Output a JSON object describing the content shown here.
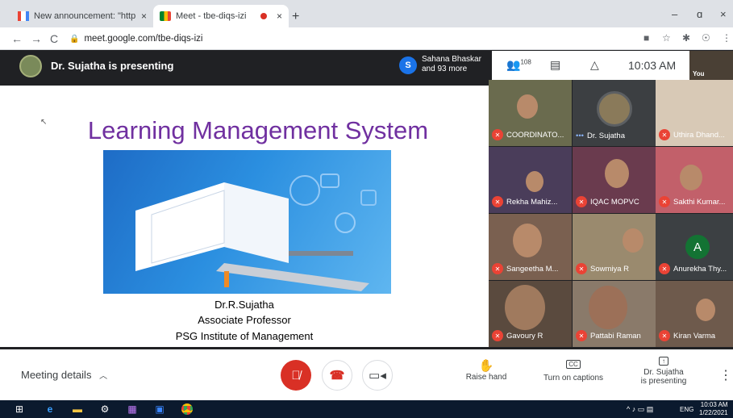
{
  "browser": {
    "tabs": [
      {
        "title": "New announcement: \"http://mee"
      },
      {
        "title": "Meet - tbe-diqs-izi"
      }
    ],
    "new_tab": "+",
    "close": "×",
    "window_controls": {
      "minimize": "–",
      "restore": "ɑ",
      "close": "×"
    },
    "address": "meet.google.com/tbe-diqs-izi",
    "nav": {
      "back": "←",
      "forward": "→",
      "reload": "C"
    }
  },
  "meet": {
    "presenting_text": "Dr. Sujatha is presenting",
    "viewers": {
      "initial": "S",
      "line1": "Sahana Bhaskar",
      "line2": "and 93 more"
    },
    "people_count": "108",
    "clock": "10:03 AM",
    "you_label": "You"
  },
  "slide": {
    "title": "Learning Management System",
    "lines": [
      "Dr.R.Sujatha",
      "Associate Professor",
      "PSG Institute of Management"
    ]
  },
  "participants": [
    {
      "name": "COORDINATO..."
    },
    {
      "name": "Dr. Sujatha"
    },
    {
      "name": "Uthira Dhand..."
    },
    {
      "name": "Rekha Mahiz..."
    },
    {
      "name": "IQAC MOPVC"
    },
    {
      "name": "Sakthi Kumar..."
    },
    {
      "name": "Sangeetha M..."
    },
    {
      "name": "Sowmiya R"
    },
    {
      "name": "Anurekha Thy...",
      "initial": "A"
    },
    {
      "name": "Gavoury R"
    },
    {
      "name": "Pattabi Raman"
    },
    {
      "name": "Kiran Varma"
    }
  ],
  "controls": {
    "meeting_details": "Meeting details",
    "raise_hand": "Raise hand",
    "captions": "Turn on captions",
    "cc": "CC",
    "presenting_line1": "Dr. Sujatha",
    "presenting_line2": "is presenting",
    "more": "⋮"
  },
  "taskbar": {
    "lang": "ENG",
    "time": "10:03 AM",
    "date": "1/22/2021"
  },
  "colors": {
    "slide_title": "#7030a0",
    "mic_off": "#ea4335",
    "accent": "#1a73e8"
  }
}
